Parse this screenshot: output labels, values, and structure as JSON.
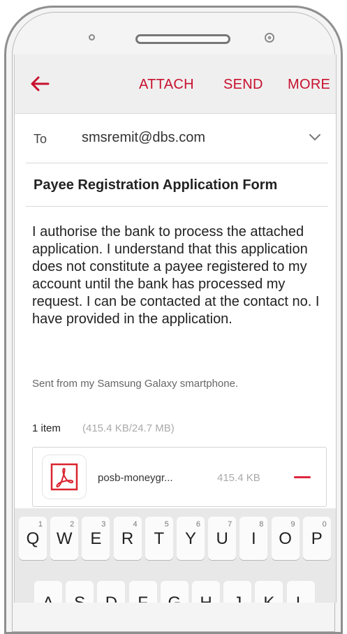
{
  "toolbar": {
    "attach": "ATTACH",
    "send": "SEND",
    "more": "MORE"
  },
  "to": {
    "label": "To",
    "value": "smsremit@dbs.com"
  },
  "subject": "Payee Registration Application Form",
  "body": "I authorise the bank to process the attached application. I understand that this application does not constitute a payee registered to my account until the bank has processed my request. I can be contacted at the contact no. I have provided in the application.",
  "signature": "Sent from my Samsung Galaxy smartphone.",
  "attachments": {
    "count": "1 item",
    "size": "(415.4 KB/24.7 MB)",
    "file": {
      "name": "posb-moneygr...",
      "size": "415.4 KB",
      "icon": "pdf-icon"
    }
  },
  "keyboard": {
    "row1": [
      {
        "letter": "Q",
        "num": "1"
      },
      {
        "letter": "W",
        "num": "2"
      },
      {
        "letter": "E",
        "num": "3"
      },
      {
        "letter": "R",
        "num": "4"
      },
      {
        "letter": "T",
        "num": "5"
      },
      {
        "letter": "Y",
        "num": "6"
      },
      {
        "letter": "U",
        "num": "7"
      },
      {
        "letter": "I",
        "num": "8"
      },
      {
        "letter": "O",
        "num": "9"
      },
      {
        "letter": "P",
        "num": "0"
      }
    ],
    "row2": [
      "A",
      "S",
      "D",
      "F",
      "G",
      "H",
      "J",
      "K",
      "L"
    ]
  },
  "colors": {
    "accent": "#c8102e",
    "remove": "#e0263e"
  }
}
